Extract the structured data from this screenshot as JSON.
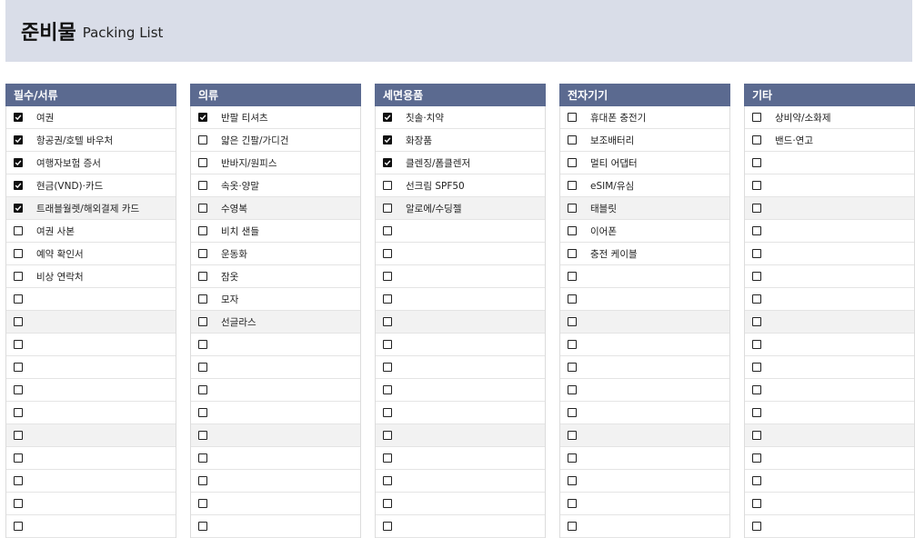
{
  "header": {
    "title": "준비물",
    "subtitle": "Packing List"
  },
  "columns": [
    {
      "title": "필수/서류",
      "items": [
        {
          "label": "여권",
          "checked": true
        },
        {
          "label": "항공권/호텔 바우처",
          "checked": true
        },
        {
          "label": "여행자보험 증서",
          "checked": true
        },
        {
          "label": "현금(VND)·카드",
          "checked": true
        },
        {
          "label": "트래블월렛/해외결제 카드",
          "checked": true
        },
        {
          "label": "여권 사본",
          "checked": false
        },
        {
          "label": "예약 확인서",
          "checked": false
        },
        {
          "label": "비상 연락처",
          "checked": false
        }
      ]
    },
    {
      "title": "의류",
      "items": [
        {
          "label": "반팔 티셔츠",
          "checked": true
        },
        {
          "label": "얇은 긴팔/가디건",
          "checked": false
        },
        {
          "label": "반바지/원피스",
          "checked": false
        },
        {
          "label": "속옷·양말",
          "checked": false
        },
        {
          "label": "수영복",
          "checked": false
        },
        {
          "label": "비치 샌들",
          "checked": false
        },
        {
          "label": "운동화",
          "checked": false
        },
        {
          "label": "잠옷",
          "checked": false
        },
        {
          "label": "모자",
          "checked": false
        },
        {
          "label": "선글라스",
          "checked": false
        }
      ]
    },
    {
      "title": "세면용품",
      "items": [
        {
          "label": "칫솔·치약",
          "checked": true
        },
        {
          "label": "화장품",
          "checked": true
        },
        {
          "label": "클렌징/폼클렌저",
          "checked": true
        },
        {
          "label": "선크림 SPF50",
          "checked": false
        },
        {
          "label": "알로에/수딩젤",
          "checked": false
        }
      ]
    },
    {
      "title": "전자기기",
      "items": [
        {
          "label": "휴대폰 충전기",
          "checked": false
        },
        {
          "label": "보조배터리",
          "checked": false
        },
        {
          "label": "멀티 어댑터",
          "checked": false
        },
        {
          "label": "eSIM/유심",
          "checked": false
        },
        {
          "label": "태블릿",
          "checked": false
        },
        {
          "label": "이어폰",
          "checked": false
        },
        {
          "label": "충전 케이블",
          "checked": false
        }
      ]
    },
    {
      "title": "기타",
      "items": [
        {
          "label": "상비약/소화제",
          "checked": false
        },
        {
          "label": "밴드·연고",
          "checked": false
        }
      ]
    }
  ]
}
